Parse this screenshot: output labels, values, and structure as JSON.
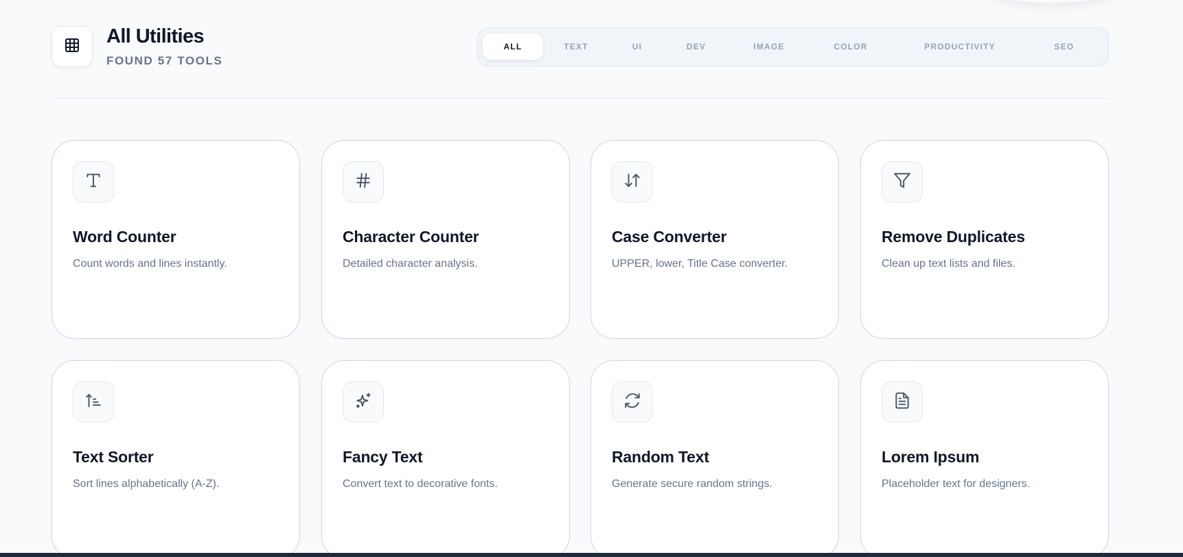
{
  "header": {
    "logo_icon": "grid-icon",
    "title": "All Utilities",
    "subtitle": "FOUND 57 TOOLS"
  },
  "filters": [
    {
      "label": "ALL",
      "active": true
    },
    {
      "label": "TEXT",
      "active": false
    },
    {
      "label": "UI",
      "active": false
    },
    {
      "label": "DEV",
      "active": false
    },
    {
      "label": "IMAGE",
      "active": false
    },
    {
      "label": "COLOR",
      "active": false
    },
    {
      "label": "PRODUCTIVITY",
      "active": false
    },
    {
      "label": "SEO",
      "active": false
    }
  ],
  "tools": [
    {
      "title": "Word Counter",
      "description": "Count words and lines instantly.",
      "icon": "type-icon"
    },
    {
      "title": "Character Counter",
      "description": "Detailed character analysis.",
      "icon": "hash-icon"
    },
    {
      "title": "Case Converter",
      "description": "UPPER, lower, Title Case converter.",
      "icon": "arrows-up-down-icon"
    },
    {
      "title": "Remove Duplicates",
      "description": "Clean up text lists and files.",
      "icon": "filter-icon"
    },
    {
      "title": "Text Sorter",
      "description": "Sort lines alphabetically (A-Z).",
      "icon": "sort-ascending-icon"
    },
    {
      "title": "Fancy Text",
      "description": "Convert text to decorative fonts.",
      "icon": "sparkles-icon"
    },
    {
      "title": "Random Text",
      "description": "Generate secure random strings.",
      "icon": "refresh-icon"
    },
    {
      "title": "Lorem Ipsum",
      "description": "Placeholder text for designers.",
      "icon": "document-icon"
    }
  ],
  "colors": {
    "background": "#f8fafc",
    "heading": "#0f172a",
    "muted": "#64748b",
    "icon": "#475569",
    "border": "#cbd5e1"
  }
}
